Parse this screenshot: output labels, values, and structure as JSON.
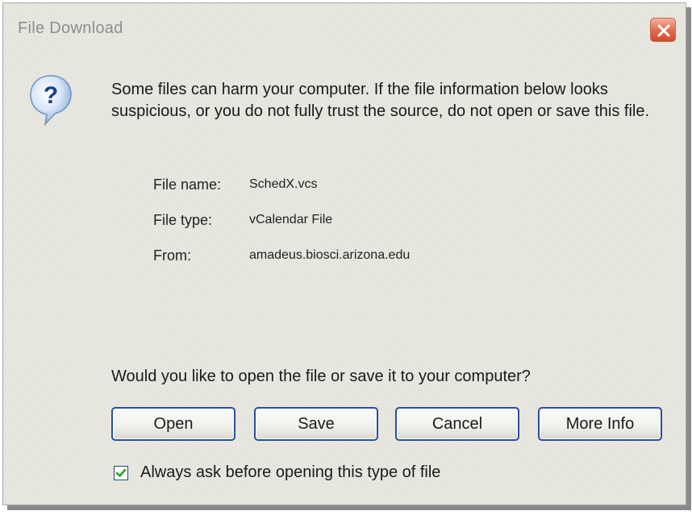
{
  "window": {
    "title": "File Download",
    "close_icon": "close-icon"
  },
  "message": {
    "icon": "question-icon",
    "warning": "Some files can harm your computer. If the file information below looks suspicious, or you do not fully trust the source, do not open or save this file."
  },
  "file_info": {
    "name_label": "File name:",
    "name_value": "SchedX.vcs",
    "type_label": "File type:",
    "type_value": "vCalendar File",
    "from_label": "From:",
    "from_value": "amadeus.biosci.arizona.edu"
  },
  "prompt": "Would you like to open the file or save it to your computer?",
  "buttons": {
    "open": "Open",
    "save": "Save",
    "cancel": "Cancel",
    "more_info": "More Info"
  },
  "always_ask": {
    "label": "Always ask before opening this type of file",
    "checked": true
  },
  "colors": {
    "button_border": "#2a4f9a",
    "close_button": "#e06a4e",
    "title_text": "#8e8e8e",
    "checkmark": "#21a121"
  }
}
